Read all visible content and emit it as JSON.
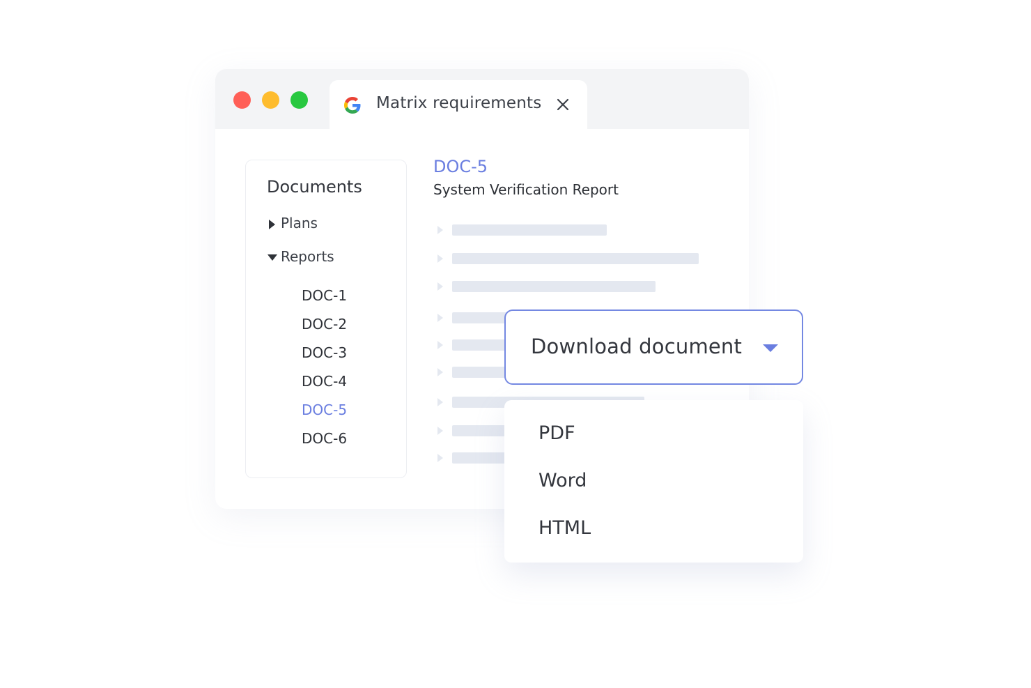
{
  "window": {
    "traffic_lights": [
      {
        "name": "close",
        "color": "#ff5f57"
      },
      {
        "name": "minimize",
        "color": "#febc2e"
      },
      {
        "name": "maximize",
        "color": "#28c840"
      }
    ]
  },
  "tab": {
    "icon": "google-g-logo",
    "title": "Matrix requirements",
    "close_icon": "close-icon"
  },
  "sidebar": {
    "title": "Documents",
    "folders": [
      {
        "label": "Plans",
        "state": "collapsed",
        "icon": "caret-right-icon"
      },
      {
        "label": "Reports",
        "state": "expanded",
        "icon": "caret-down-icon"
      }
    ],
    "documents": [
      {
        "label": "DOC-1",
        "active": false
      },
      {
        "label": "DOC-2",
        "active": false
      },
      {
        "label": "DOC-3",
        "active": false
      },
      {
        "label": "DOC-4",
        "active": false
      },
      {
        "label": "DOC-5",
        "active": true
      },
      {
        "label": "DOC-6",
        "active": false
      }
    ]
  },
  "main": {
    "doc_id": "DOC-5",
    "doc_title": "System Verification Report"
  },
  "download": {
    "label": "Download document",
    "icon": "chevron-down-icon",
    "options": [
      "PDF",
      "Word",
      "HTML"
    ]
  },
  "colors": {
    "accent": "#6a7ee0",
    "button_border": "#7488e2",
    "placeholder_bar": "#e4e8f0",
    "titlebar": "#f3f4f6"
  }
}
